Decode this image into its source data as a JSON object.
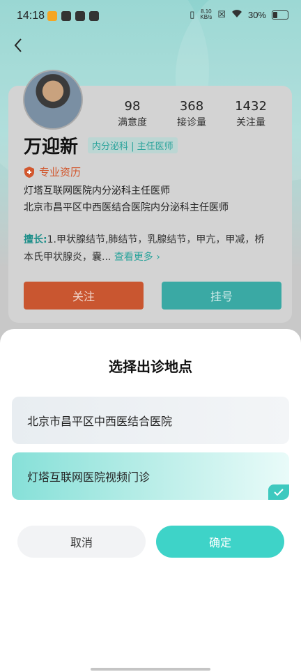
{
  "status_bar": {
    "time": "14:18",
    "net_speed_value": "8.10",
    "net_speed_unit": "KB/s",
    "battery": "30%"
  },
  "doctor": {
    "name": "万迎新",
    "tag": "内分泌科 | 主任医师",
    "stats": [
      {
        "value": "98",
        "label": "满意度"
      },
      {
        "value": "368",
        "label": "接诊量"
      },
      {
        "value": "1432",
        "label": "关注量"
      }
    ],
    "qualification_title": "专业资历",
    "positions": [
      "灯塔互联网医院内分泌科主任医师",
      "北京市昌平区中西医结合医院内分泌科主任医师"
    ],
    "specialty_label": "擅长:",
    "specialty_text": "1.甲状腺结节,肺结节，乳腺结节，甲亢，甲减，桥本氏甲状腺炎，囊...",
    "see_more": "查看更多"
  },
  "buttons": {
    "follow": "关注",
    "register": "挂号"
  },
  "sheet": {
    "title": "选择出诊地点",
    "options": [
      {
        "label": "北京市昌平区中西医结合医院",
        "selected": false
      },
      {
        "label": "灯塔互联网医院视频门诊",
        "selected": true
      }
    ],
    "cancel": "取消",
    "confirm": "确定"
  },
  "colors": {
    "accent": "#3ed3c8",
    "follow_button": "#c95630",
    "register_button": "#3aa9a4"
  }
}
